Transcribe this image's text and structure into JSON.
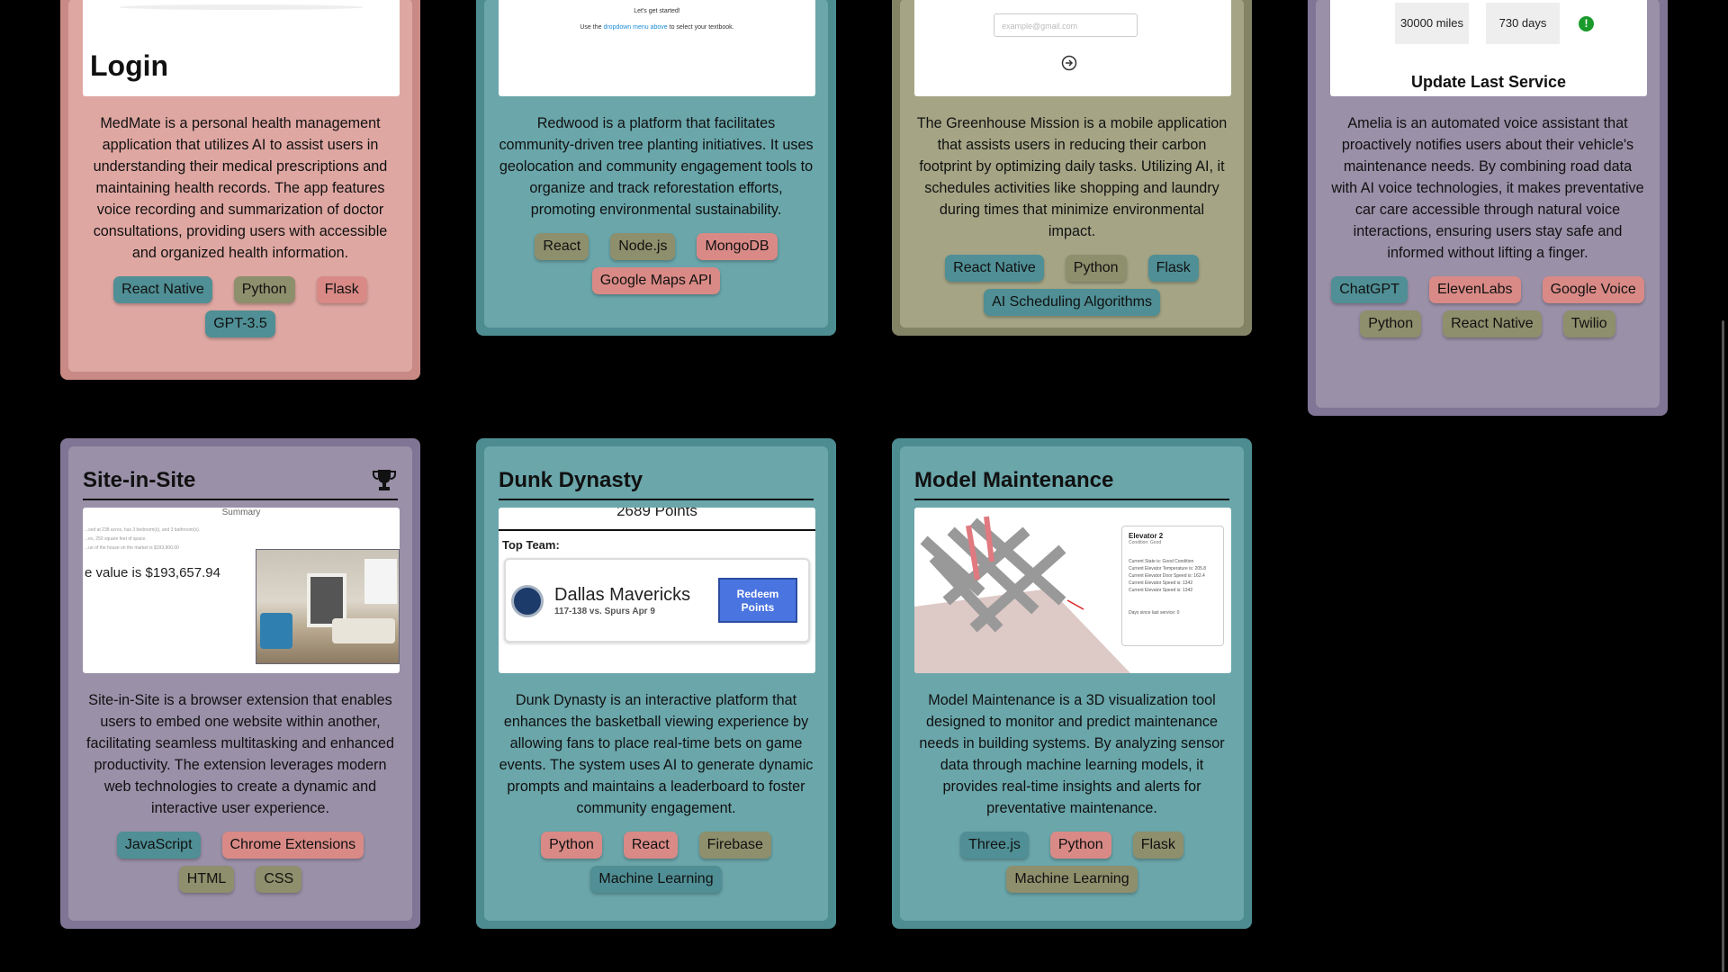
{
  "cards": [
    {
      "title": "",
      "shot_text": "Login",
      "description": "MedMate is a personal health management application that utilizes AI to assist users in understanding their medical prescriptions and maintaining health records. The app features voice recording and summarization of doctor consultations, providing users with accessible and organized health information.",
      "tags": [
        "React Native",
        "Python",
        "Flask",
        "GPT-3.5"
      ]
    },
    {
      "title": "",
      "shot_line1": "Let's get started!",
      "shot_line2_a": "Use the",
      "shot_line2_link": "dropdown menu above",
      "shot_line2_b": "to select your textbook.",
      "description": "Redwood is a platform that facilitates community-driven tree planting initiatives. It uses geolocation and community engagement tools to organize and track reforestation efforts, promoting environmental sustainability.",
      "tags": [
        "React",
        "Node.js",
        "MongoDB",
        "Google Maps API"
      ]
    },
    {
      "title": "",
      "shot_input_placeholder": "example@gmail.com",
      "description": "The Greenhouse Mission is a mobile application that assists users in reducing their carbon footprint by optimizing daily tasks. Utilizing AI, it schedules activities like shopping and laundry during times that minimize environmental impact.",
      "tags": [
        "React Native",
        "Python",
        "Flask",
        "AI Scheduling Algorithms"
      ]
    },
    {
      "title": "",
      "shot_miles": "30000 miles",
      "shot_days": "730 days",
      "shot_heading": "Update Last Service",
      "description": "Amelia is an automated voice assistant that proactively notifies users about their vehicle's maintenance needs. By combining road data with AI voice technologies, it makes preventative car care accessible through natural voice interactions, ensuring users stay safe and informed without lifting a finger.",
      "tags": [
        "ChatGPT",
        "ElevenLabs",
        "Google Voice",
        "Python",
        "React Native",
        "Twilio"
      ]
    },
    {
      "title": "Site-in-Site",
      "shot_summary": "Summary",
      "shot_small1": "...sed at 238 acres, has 3 bedroom(s), and 3 bathroom(s).",
      "shot_small2": "...es, 250 square feet of space.",
      "shot_small3": "...ue of the house on the market is $193,900.00",
      "shot_value": "e value is $193,657.94",
      "description": "Site-in-Site is a browser extension that enables users to embed one website within another, facilitating seamless multitasking and enhanced productivity. The extension leverages modern web technologies to create a dynamic and interactive user experience.",
      "tags": [
        "JavaScript",
        "Chrome Extensions",
        "HTML",
        "CSS"
      ]
    },
    {
      "title": "Dunk Dynasty",
      "shot_points": "2689 Points",
      "shot_top_team": "Top Team:",
      "shot_team_name": "Dallas Mavericks",
      "shot_team_score": "117-138 vs. Spurs Apr 9",
      "shot_redeem": "Redeem Points",
      "description": "Dunk Dynasty is an interactive platform that enhances the basketball viewing experience by allowing fans to place real-time bets on game events. The system uses AI to generate dynamic prompts and maintains a leaderboard to foster community engagement.",
      "tags": [
        "Python",
        "React",
        "Firebase",
        "Machine Learning"
      ]
    },
    {
      "title": "Model Maintenance",
      "shot_panel_title": "Elevator 2",
      "shot_panel_sub": "Condition: Good",
      "shot_panel_lines": [
        "Current State is: Good Condition",
        "Current Elevator Temperature is: 205.8",
        "Current Elevator Door Speed is: 162.4",
        "Current Elevator Speed is: 1342",
        "Current Elevator Speed is: 1342"
      ],
      "shot_panel_footer": "Days since last service: 0",
      "description": "Model Maintenance is a 3D visualization tool designed to monitor and predict maintenance needs in building systems. By analyzing sensor data through machine learning models, it provides real-time insights and alerts for preventative maintenance.",
      "tags": [
        "Three.js",
        "Python",
        "Flask",
        "Machine Learning"
      ]
    }
  ],
  "icons": {
    "trophy": "trophy-icon",
    "logout": "logout-icon",
    "alert": "alert-icon",
    "team_logo": "mavericks-logo-icon"
  },
  "colors": {
    "teal": "#6aa6aa",
    "pink": "#dfa7a2",
    "olive": "#a5a586",
    "mauve": "#9a90a8",
    "link": "#1a8cd8",
    "redeem": "#4a74e0"
  }
}
